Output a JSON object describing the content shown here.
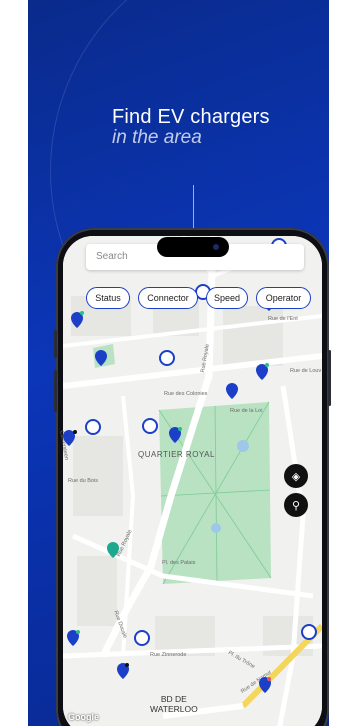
{
  "headline": {
    "line1": "Find EV chargers",
    "line2": "in the area"
  },
  "search": {
    "placeholder": "Search"
  },
  "filters": [
    "Status",
    "Connector",
    "Speed",
    "Operator"
  ],
  "map": {
    "district": "QUARTIER ROYAL",
    "boulevard": [
      "BD DE",
      "WATERLOO"
    ],
    "attribution": "Google",
    "streets": [
      "Rue Royale",
      "Rue des Colonies",
      "Rue de la Loi",
      "Rue de Louv",
      "Rue de l'Ent",
      "Rue du Bois",
      "Cantersteen",
      "Rue Royale",
      "Pl. des Palais",
      "Rue Ducale",
      "Rue Zinnerode",
      "Pl. du Trône",
      "Rue de Namur"
    ],
    "pin_color": "#1c3fc8",
    "park_color": "#b8e2c2"
  },
  "buttons": {
    "locate": "locate-icon",
    "user": "user-location-icon"
  }
}
